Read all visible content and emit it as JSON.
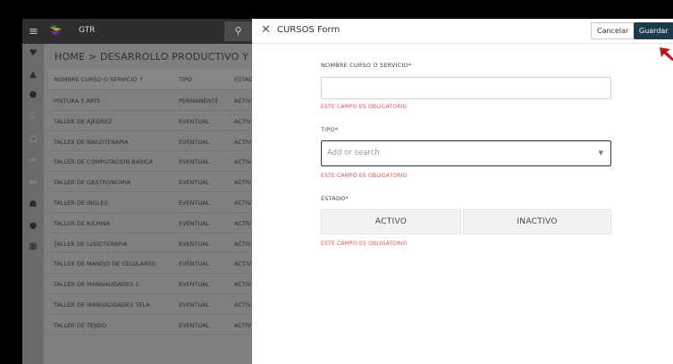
{
  "app": {
    "brand": "GTR",
    "breadcrumb": "HOME  >  DESARROLLO PRODUCTIVO Y ECONO"
  },
  "table": {
    "headers": [
      "NOMBRE CURSO O SERVICIO ↑",
      "TIPO",
      "ESTAD"
    ],
    "rows": [
      [
        "PINTURA Y ARTE",
        "PERMANENTE",
        "ACTIV"
      ],
      [
        "TALLER DE AJEDREZ",
        "EVENTUAL",
        "ACTIV"
      ],
      [
        "TALLER DE BAILOTERAPIA",
        "EVENTUAL",
        "ACTIV"
      ],
      [
        "TALLER DE COMPUTACION BASICA",
        "EVENTUAL",
        "ACTIV"
      ],
      [
        "TALLER DE GASTRONOMIA",
        "EVENTUAL",
        "ACTIV"
      ],
      [
        "TALLER DE INGLES",
        "EVENTUAL",
        "ACTIV"
      ],
      [
        "TALLER DE KICHWA",
        "EVENTUAL",
        "ACTIV"
      ],
      [
        "TALLER DE LUDOTERAPIA",
        "EVENTUAL",
        "ACTIV"
      ],
      [
        "TALLER DE MANEJO DE CELULARES",
        "EVENTUAL",
        "ACTIV"
      ],
      [
        "TALLER DE MANUALIDADES 1",
        "EVENTUAL",
        "ACTIV"
      ],
      [
        "TALLER DE MANUALIDADES TELA",
        "EVENTUAL",
        "ACTIV"
      ],
      [
        "TALLER DE TEJIDO",
        "EVENTUAL",
        "ACTIV"
      ]
    ]
  },
  "form": {
    "title": "CURSOS Form",
    "cancel_label": "Cancelar",
    "save_label": "Guardar",
    "nombre_label": "NOMBRE CURSO O SERVICIO*",
    "nombre_value": "",
    "nombre_error": "ESTE CAMPO ES OBLIGATORIO",
    "tipo_label": "TIPO*",
    "tipo_placeholder": "Add or search",
    "tipo_error": "ESTE CAMPO ES OBLIGATORIO",
    "estado_label": "ESTADO*",
    "estado_options": [
      "ACTIVO",
      "INACTIVO"
    ],
    "estado_error": "ESTE CAMPO ES OBLIGATORIO"
  },
  "colors": {
    "primary": "#1b3a4b",
    "error": "#d9534f",
    "annotation_arrow": "#c0141b"
  },
  "icons": [
    "menu-icon",
    "logo-icon",
    "search-icon",
    "close-icon",
    "chevron-down-icon",
    "arrow-pointer-icon"
  ]
}
